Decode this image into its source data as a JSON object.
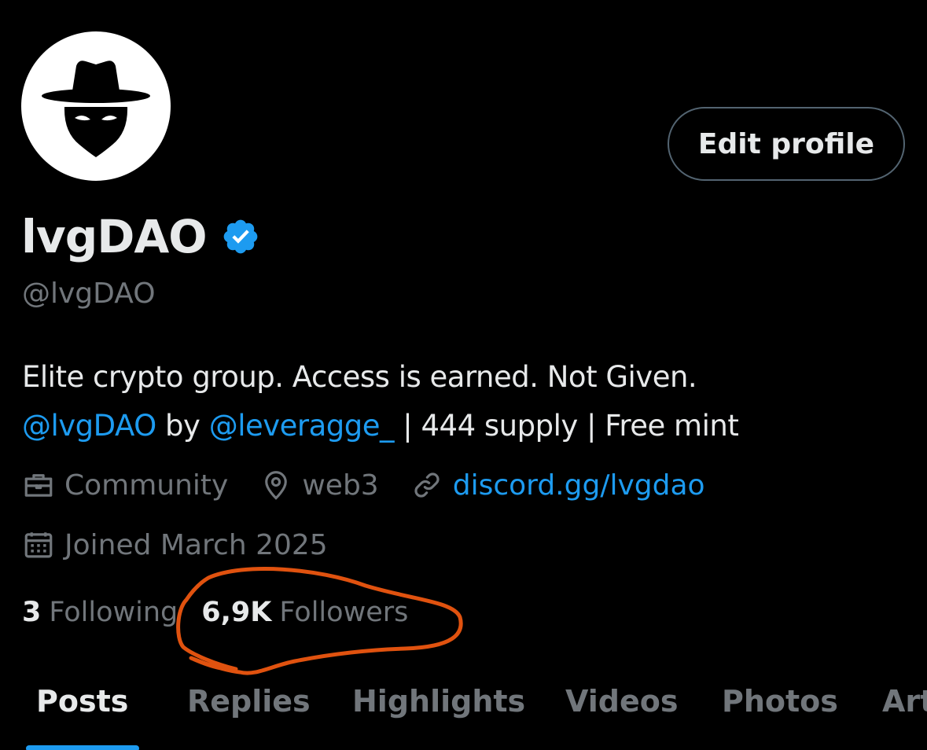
{
  "profile": {
    "display_name": "lvgDAO",
    "handle": "@lvgDAO",
    "edit_button_label": "Edit profile",
    "avatar_icon": "incognito-hat-mask-icon",
    "verified_icon": "verified-badge-icon"
  },
  "bio": {
    "line1": "Elite crypto group. Access is earned. Not Given.",
    "mention1": "@lvgDAO",
    "by_text": " by ",
    "mention2": "@leveragge_",
    "line2_rest": " | 444 supply | Free mint"
  },
  "meta": {
    "category": "Community",
    "location": "web3",
    "link": "discord.gg/lvgdao",
    "joined": "Joined March 2025"
  },
  "stats": {
    "following_count": "3",
    "following_label": "Following",
    "followers_count": "6,9K",
    "followers_label": "Followers"
  },
  "tabs": [
    {
      "label": "Posts"
    },
    {
      "label": "Replies"
    },
    {
      "label": "Highlights"
    },
    {
      "label": "Videos"
    },
    {
      "label": "Photos"
    },
    {
      "label": "Articles"
    }
  ],
  "colors": {
    "background": "#000000",
    "text_primary": "#e7e9ea",
    "text_secondary": "#71767b",
    "accent": "#1d9bf0",
    "annotation": "#e0520f"
  }
}
